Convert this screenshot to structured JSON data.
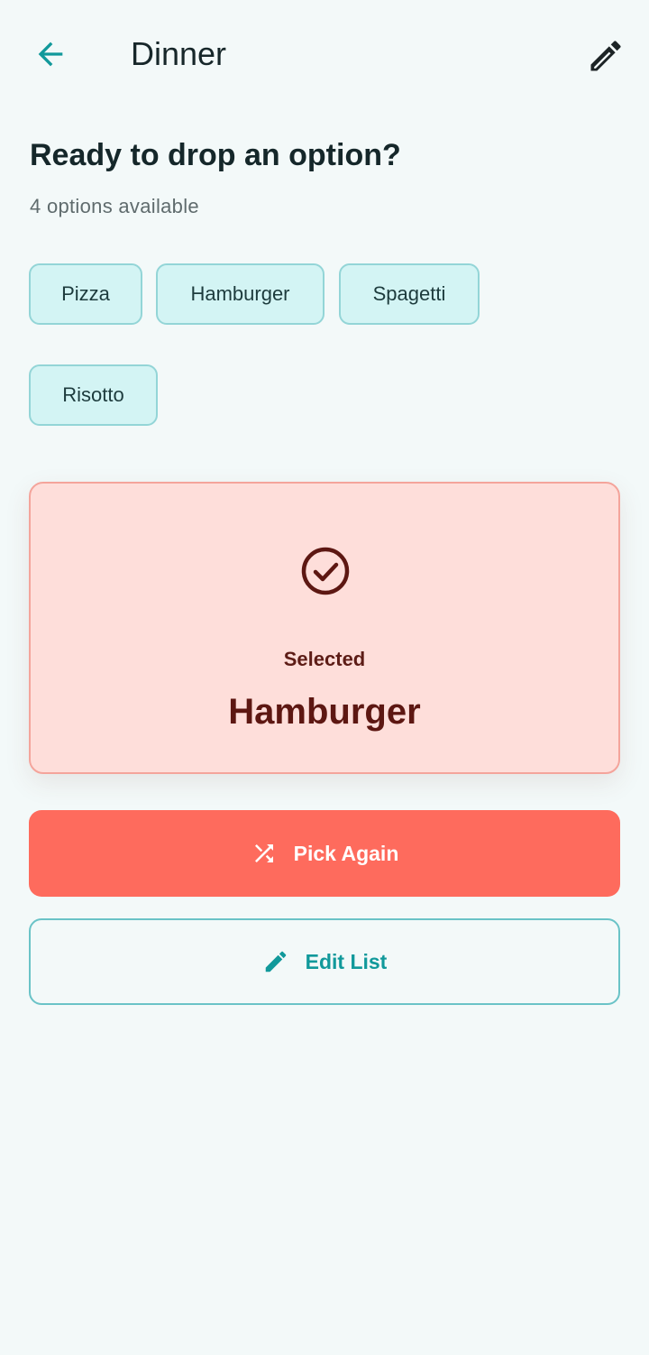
{
  "app_bar": {
    "title": "Dinner",
    "back_icon": "arrow-left-icon",
    "edit_icon": "pencil-icon"
  },
  "heading": "Ready to drop an option?",
  "subheading": "4 options available",
  "options": [
    "Pizza",
    "Hamburger",
    "Spagetti",
    "Risotto"
  ],
  "result": {
    "icon": "check-circle-icon",
    "label": "Selected",
    "value": "Hamburger"
  },
  "actions": {
    "pick_again_label": "Pick Again",
    "pick_again_icon": "shuffle-icon",
    "edit_list_label": "Edit List",
    "edit_list_icon": "pencil-icon"
  },
  "colors": {
    "background": "#f3f9f9",
    "accent_teal": "#11999b",
    "chip_bg": "#d3f4f4",
    "result_bg": "#fededa",
    "primary_button": "#fe6b5d",
    "result_text": "#5d1712"
  }
}
